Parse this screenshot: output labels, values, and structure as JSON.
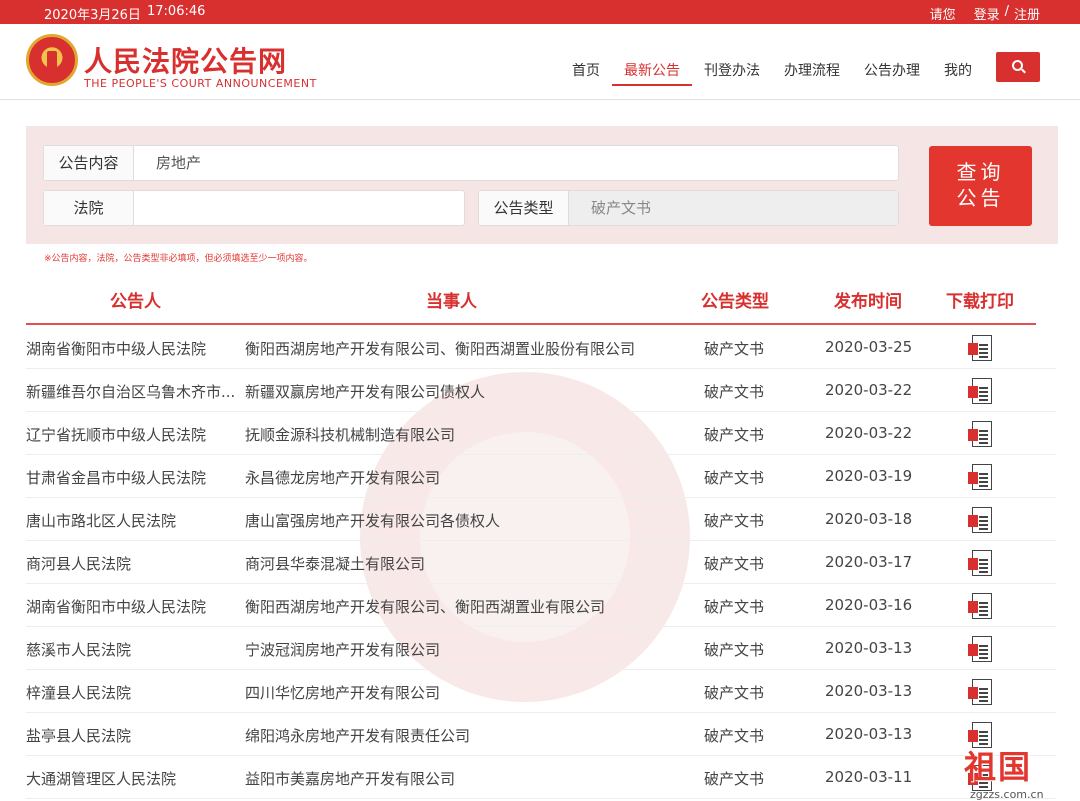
{
  "topbar": {
    "date": "2020年3月26日",
    "time": "17:06:46",
    "greeting": "请您",
    "login": "登录",
    "separator": "/",
    "register": "注册"
  },
  "header": {
    "logo_title": "人民法院公告网",
    "logo_subtitle": "THE PEOPLE'S COURT ANNOUNCEMENT",
    "nav": [
      {
        "label": "首页",
        "active": false
      },
      {
        "label": "最新公告",
        "active": true
      },
      {
        "label": "刊登办法",
        "active": false
      },
      {
        "label": "办理流程",
        "active": false
      },
      {
        "label": "公告办理",
        "active": false
      },
      {
        "label": "我的",
        "active": false
      }
    ],
    "search_icon": "search-icon"
  },
  "search": {
    "content_label": "公告内容",
    "content_value": "房地产",
    "court_label": "法院",
    "court_value": "",
    "type_label": "公告类型",
    "type_value": "破产文书",
    "query_line1": "查询",
    "query_line2": "公告",
    "hint": "※公告内容，法院，公告类型非必填项，但必须填选至少一项内容。"
  },
  "table": {
    "headers": [
      "公告人",
      "当事人",
      "公告类型",
      "发布时间",
      "下载打印"
    ],
    "rows": [
      {
        "court": "湖南省衡阳市中级人民法院",
        "party": "衡阳西湖房地产开发有限公司、衡阳西湖置业股份有限公司",
        "type": "破产文书",
        "date": "2020-03-25"
      },
      {
        "court": "新疆维吾尔自治区乌鲁木齐市...",
        "party": "新疆双赢房地产开发有限公司债权人",
        "type": "破产文书",
        "date": "2020-03-22"
      },
      {
        "court": "辽宁省抚顺市中级人民法院",
        "party": "抚顺金源科技机械制造有限公司",
        "type": "破产文书",
        "date": "2020-03-22"
      },
      {
        "court": "甘肃省金昌市中级人民法院",
        "party": "永昌德龙房地产开发有限公司",
        "type": "破产文书",
        "date": "2020-03-19"
      },
      {
        "court": "唐山市路北区人民法院",
        "party": "唐山富强房地产开发有限公司各债权人",
        "type": "破产文书",
        "date": "2020-03-18"
      },
      {
        "court": "商河县人民法院",
        "party": "商河县华泰混凝土有限公司",
        "type": "破产文书",
        "date": "2020-03-17"
      },
      {
        "court": "湖南省衡阳市中级人民法院",
        "party": "衡阳西湖房地产开发有限公司、衡阳西湖置业有限公司",
        "type": "破产文书",
        "date": "2020-03-16"
      },
      {
        "court": "慈溪市人民法院",
        "party": "宁波冠润房地产开发有限公司",
        "type": "破产文书",
        "date": "2020-03-13"
      },
      {
        "court": "梓潼县人民法院",
        "party": "四川华忆房地产开发有限公司",
        "type": "破产文书",
        "date": "2020-03-13"
      },
      {
        "court": "盐亭县人民法院",
        "party": "绵阳鸿永房地产开发有限责任公司",
        "type": "破产文书",
        "date": "2020-03-13"
      },
      {
        "court": "大通湖管理区人民法院",
        "party": "益阳市美嘉房地产开发有限公司",
        "type": "破产文书",
        "date": "2020-03-11"
      }
    ]
  },
  "brand": {
    "name": "祖国",
    "site": "zgzzs.com.cn"
  },
  "colors": {
    "accent": "#d8302f",
    "panel": "#f5e5e5"
  }
}
